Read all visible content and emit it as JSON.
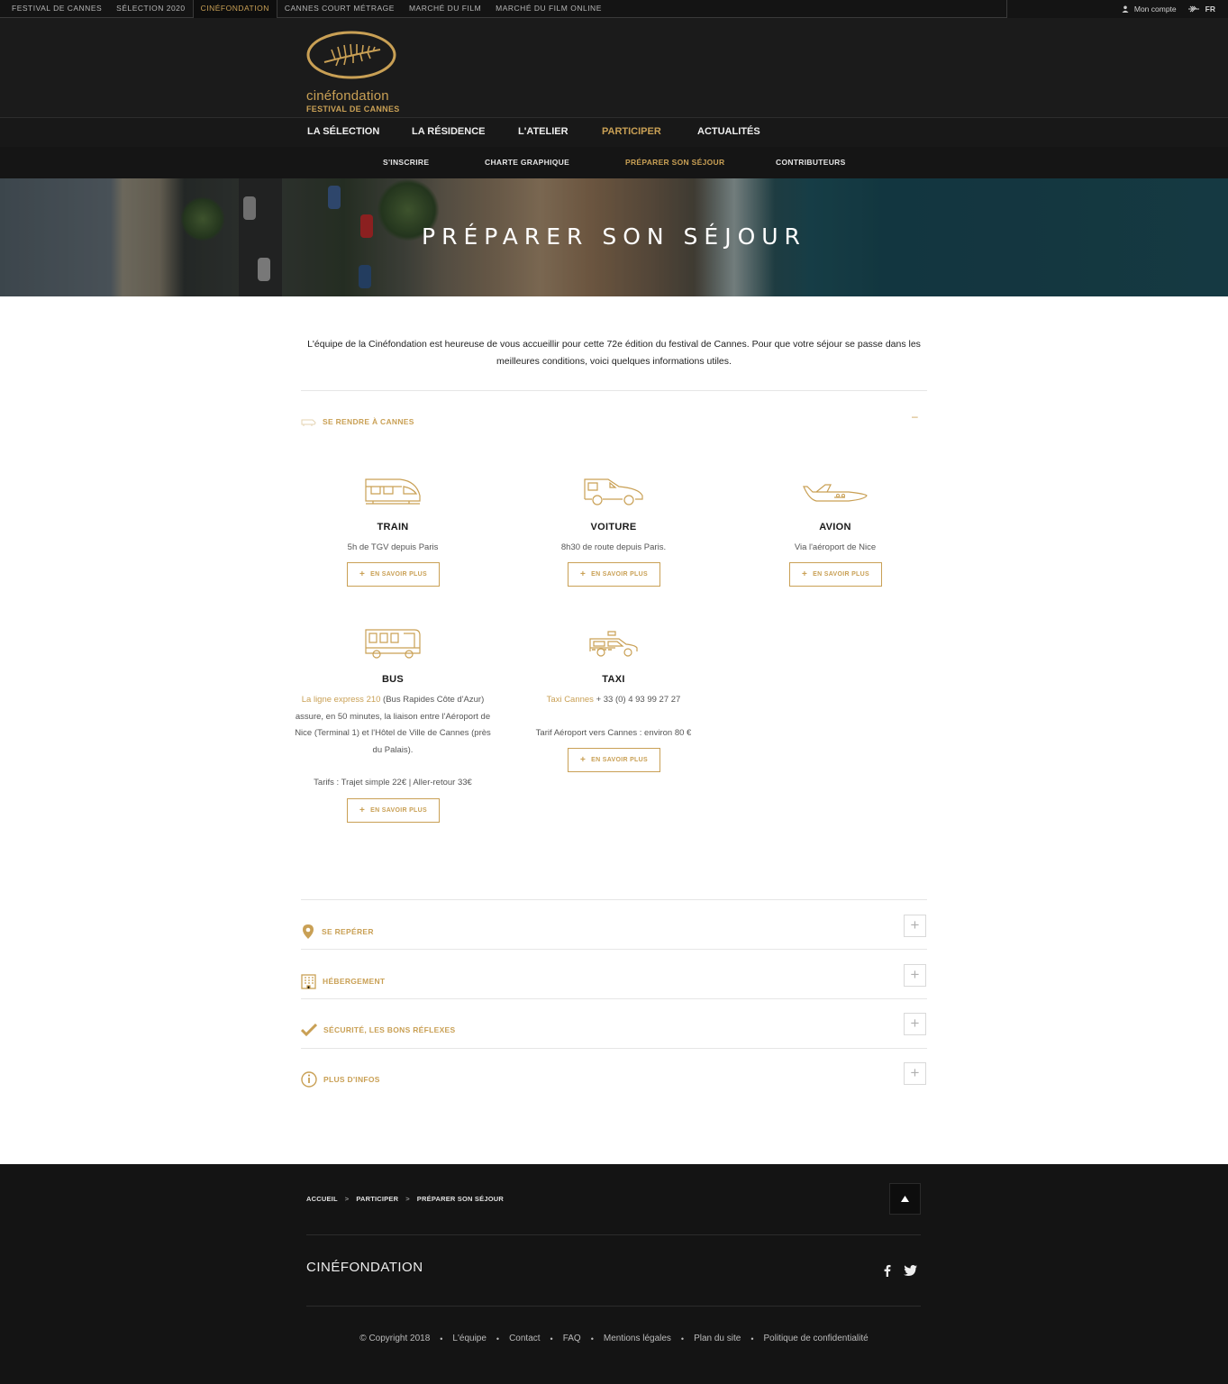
{
  "topbar": {
    "items": [
      "FESTIVAL DE CANNES",
      "SÉLECTION 2020",
      "CINÉFONDATION",
      "CANNES COURT MÉTRAGE",
      "MARCHÉ DU FILM",
      "MARCHÉ DU FILM ONLINE"
    ],
    "active_index": 2,
    "account_label": "Mon compte",
    "lang_label": "FR"
  },
  "logo": {
    "line1": "cinéfondation",
    "line2": "FESTIVAL DE CANNES"
  },
  "main_nav": [
    "LA SÉLECTION",
    "LA RÉSIDENCE",
    "L'ATELIER",
    "PARTICIPER",
    "ACTUALITÉS"
  ],
  "main_nav_active": 3,
  "sub_nav": [
    "S'INSCRIRE",
    "CHARTE GRAPHIQUE",
    "PRÉPARER SON SÉJOUR",
    "CONTRIBUTEURS"
  ],
  "sub_nav_active": 2,
  "hero": {
    "title": "PRÉPARER SON SÉJOUR"
  },
  "intro": "L'équipe de la Cinéfondation est heureuse de vous accueillir pour cette 72e édition du festival de Cannes. Pour que votre séjour se passe dans les meilleures conditions, voici quelques informations utiles.",
  "open_section": {
    "title": "SE RENDRE À CANNES",
    "toggle": "–"
  },
  "transports": [
    {
      "title": "TRAIN",
      "desc": "5h de TGV depuis Paris",
      "button": "EN SAVOIR PLUS"
    },
    {
      "title": "VOITURE",
      "desc": "8h30 de route depuis Paris.",
      "button": "EN SAVOIR PLUS"
    },
    {
      "title": "AVION",
      "desc": "Via l'aéroport de Nice",
      "button": "EN SAVOIR PLUS"
    },
    {
      "title": "BUS",
      "link": "La ligne express 210",
      "desc": " (Bus Rapides Côte d'Azur) assure, en 50 minutes, la liaison entre l'Aéroport de Nice (Terminal 1) et l'Hôtel de Ville de Cannes (près du Palais).",
      "desc2": "Tarifs : Trajet simple 22€ | Aller-retour 33€",
      "button": "EN SAVOIR PLUS"
    },
    {
      "title": "TAXI",
      "link": "Taxi Cannes",
      "desc": " + 33 (0) 4 93 99 27 27",
      "desc2": "Tarif Aéroport vers Cannes : environ 80 €",
      "button": "EN SAVOIR PLUS"
    }
  ],
  "sections": [
    {
      "title": "SE REPÉRER",
      "icon": "map-pin-icon",
      "toggle": "+"
    },
    {
      "title": "HÉBERGEMENT",
      "icon": "building-icon",
      "toggle": "+"
    },
    {
      "title": "SÉCURITÉ, LES BONS RÉFLEXES",
      "icon": "checkmark-icon",
      "toggle": "+"
    },
    {
      "title": "PLUS D'INFOS",
      "icon": "info-icon",
      "toggle": "+"
    }
  ],
  "footer": {
    "breadcrumb": [
      "ACCUEIL",
      "PARTICIPER",
      "PRÉPARER SON SÉJOUR"
    ],
    "breadcrumb_sep": ">",
    "brand": "CINÉFONDATION",
    "links": [
      "© Copyright 2018",
      "L'équipe",
      "Contact",
      "FAQ",
      "Mentions légales",
      "Plan du site",
      "Politique de confidentialité"
    ]
  },
  "colors": {
    "accent": "#c9a055",
    "dark": "#141414"
  }
}
